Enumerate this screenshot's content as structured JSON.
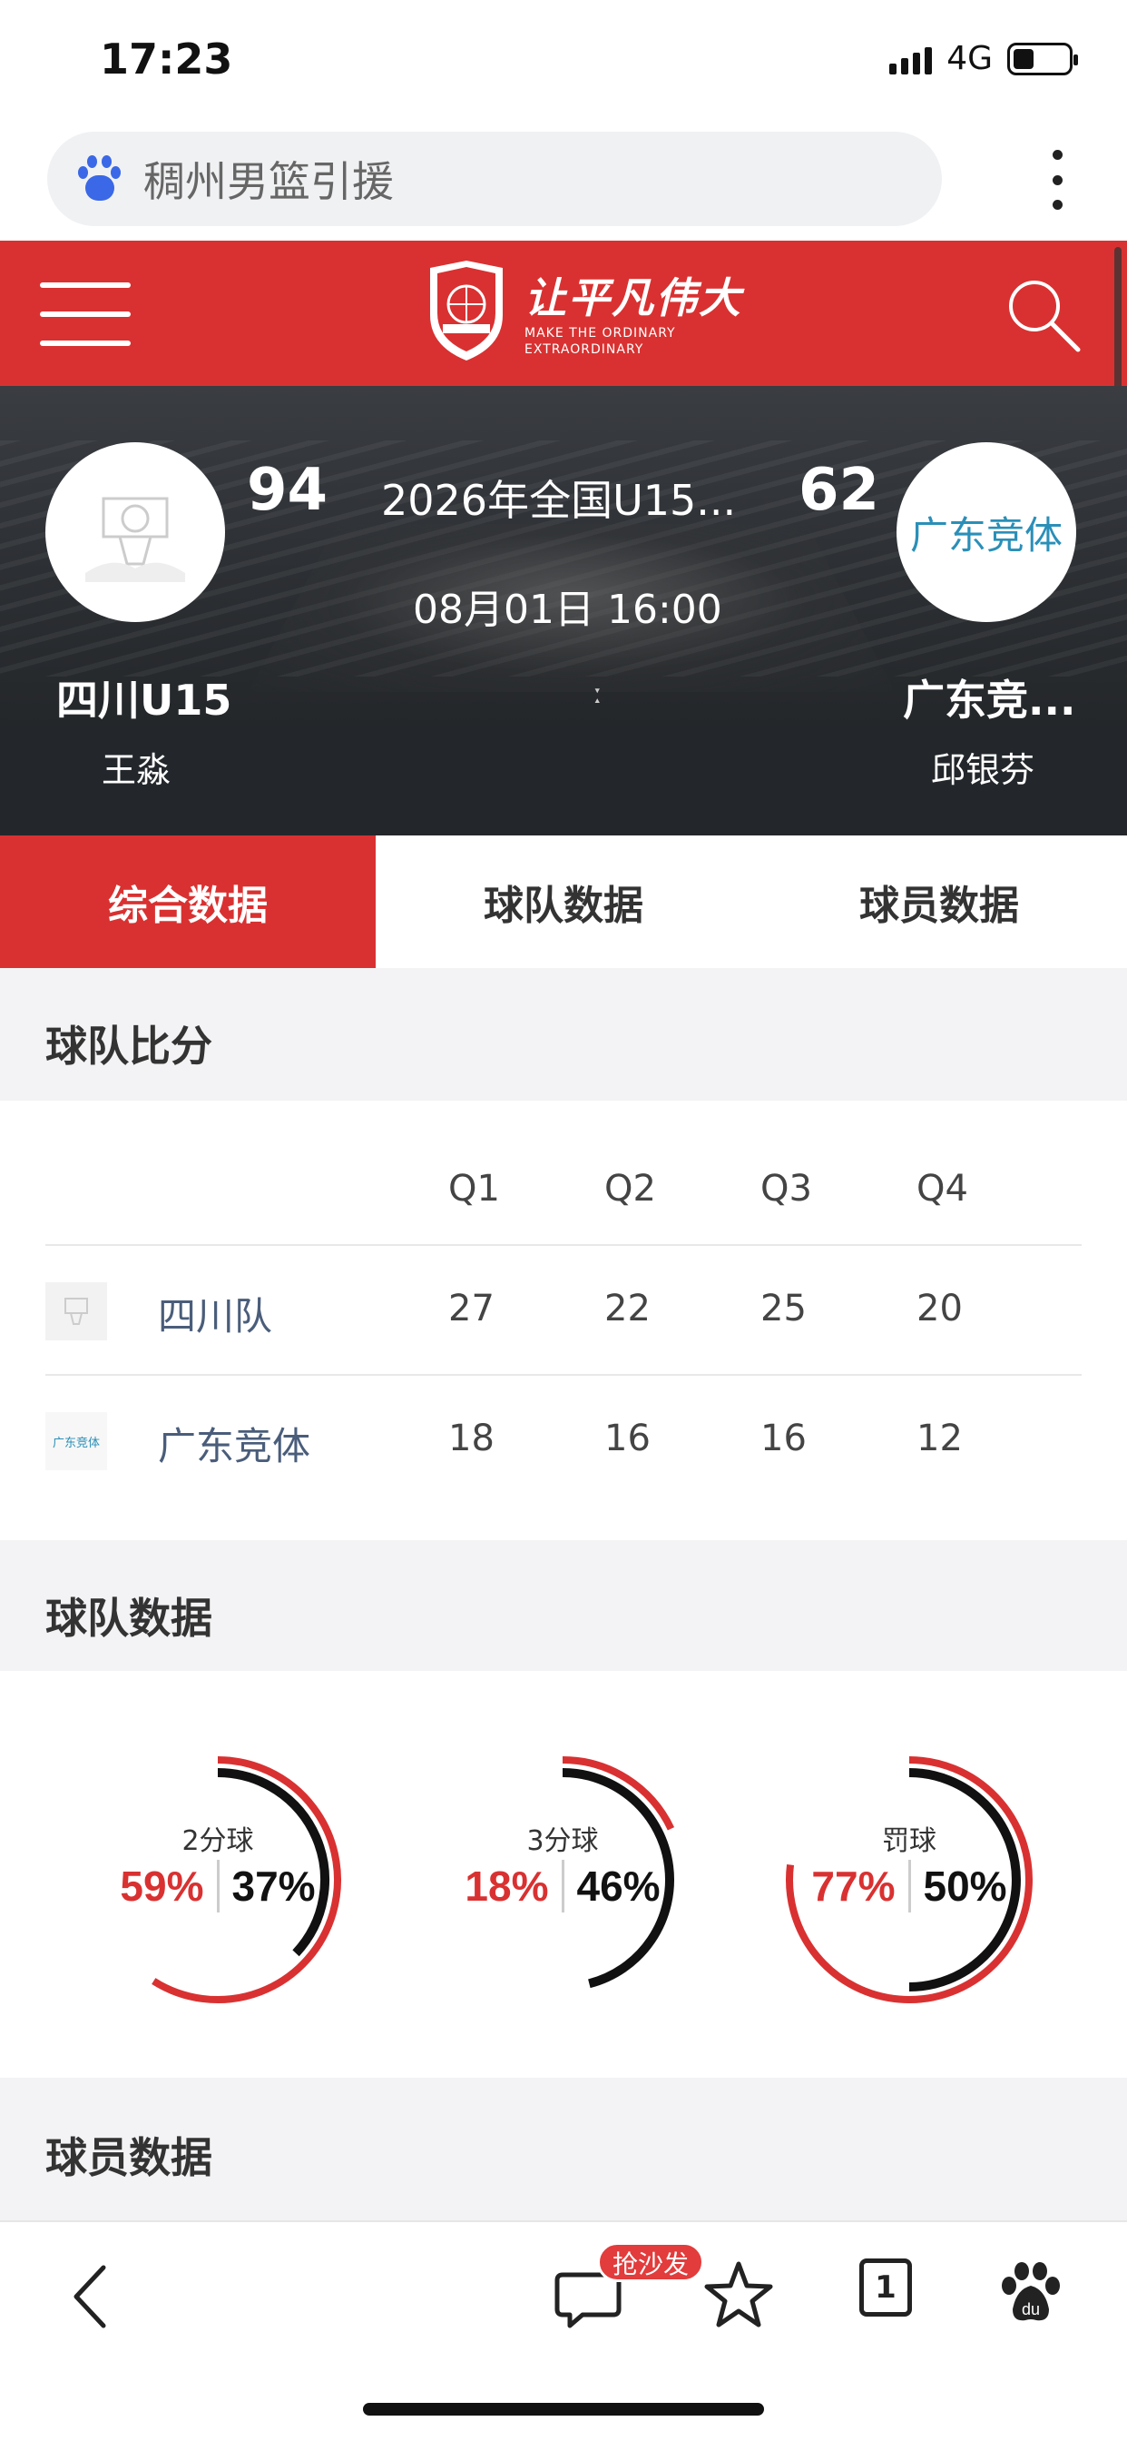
{
  "status_bar": {
    "time": "17:23",
    "network": "4G"
  },
  "search": {
    "query": "稠州男篮引援"
  },
  "header": {
    "slogan_cn": "让平凡伟大",
    "slogan_en_line1": "MAKE THE ORDINARY",
    "slogan_en_line2": "EXTRAORDINARY",
    "brand_color": "#d93131"
  },
  "match": {
    "title": "2026年全国U15...",
    "datetime": "08月01日 16:00",
    "center_mark": "ː",
    "home": {
      "name": "四川U15",
      "coach": "王淼",
      "score": "94"
    },
    "away": {
      "name": "广东竞...",
      "coach": "邱银芬",
      "score": "62",
      "logo_text": "广东竞体"
    }
  },
  "tabs": [
    {
      "label": "综合数据",
      "active": true
    },
    {
      "label": "球队数据",
      "active": false
    },
    {
      "label": "球员数据",
      "active": false
    }
  ],
  "team_score": {
    "section_title": "球队比分",
    "quarters": [
      "Q1",
      "Q2",
      "Q3",
      "Q4"
    ],
    "rows": [
      {
        "team": "四川队",
        "scores": [
          "27",
          "22",
          "25",
          "20"
        ]
      },
      {
        "team": "广东竞体",
        "logo_text": "广东竞体",
        "scores": [
          "18",
          "16",
          "16",
          "12"
        ]
      }
    ]
  },
  "team_data": {
    "section_title": "球队数据",
    "stats": [
      {
        "label": "2分球",
        "home": "59%",
        "away": "37%",
        "home_pct": 59,
        "away_pct": 37
      },
      {
        "label": "3分球",
        "home": "18%",
        "away": "46%",
        "home_pct": 18,
        "away_pct": 46
      },
      {
        "label": "罚球",
        "home": "77%",
        "away": "50%",
        "home_pct": 77,
        "away_pct": 50
      }
    ]
  },
  "player_data": {
    "section_title": "球员数据"
  },
  "bottom_nav": {
    "sofa_label": "抢沙发",
    "tab_count": "1"
  },
  "colors": {
    "accent_red": "#d93131",
    "away_blue": "#2a8fb8"
  }
}
